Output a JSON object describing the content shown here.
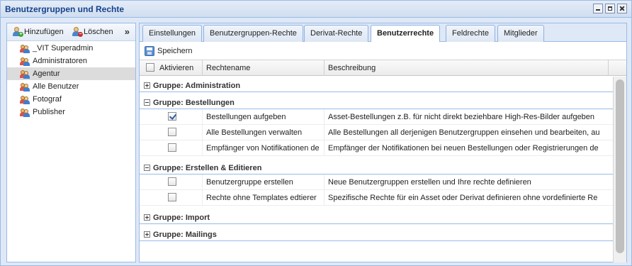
{
  "window": {
    "title": "Benutzergruppen und Rechte"
  },
  "left": {
    "add_label": "Hinzufügen",
    "delete_label": "Löschen",
    "collapse_symbol": "»",
    "groups": [
      {
        "name": "_VIT Superadmin",
        "selected": false
      },
      {
        "name": "Administratoren",
        "selected": false
      },
      {
        "name": "Agentur",
        "selected": true
      },
      {
        "name": "Alle Benutzer",
        "selected": false
      },
      {
        "name": "Fotograf",
        "selected": false
      },
      {
        "name": "Publisher",
        "selected": false
      }
    ]
  },
  "tabs": [
    {
      "label": "Einstellungen",
      "active": false
    },
    {
      "label": "Benutzergruppen-Rechte",
      "active": false
    },
    {
      "label": "Derivat-Rechte",
      "active": false
    },
    {
      "label": "Benutzerrechte",
      "active": true
    },
    {
      "label": "Feldrechte",
      "active": false
    },
    {
      "label": "Mitglieder",
      "active": false
    }
  ],
  "toolbar": {
    "save_label": "Speichern"
  },
  "grid": {
    "col_activate": "Aktivieren",
    "col_name": "Rechtename",
    "col_desc": "Beschreibung",
    "groups": [
      {
        "title": "Gruppe: Administration",
        "expanded": false,
        "rows": []
      },
      {
        "title": "Gruppe: Bestellungen",
        "expanded": true,
        "rows": [
          {
            "checked": true,
            "name": "Bestellungen aufgeben",
            "desc": "Asset-Bestellungen z.B. für nicht direkt beziehbare High-Res-Bilder aufgeben"
          },
          {
            "checked": false,
            "name": "Alle Bestellungen verwalten",
            "desc": "Alle Bestellungen all derjenigen Benutzergruppen einsehen und bearbeiten, au"
          },
          {
            "checked": false,
            "name": "Empfänger von Notifikationen de",
            "desc": "Empfänger der Notifikationen bei neuen Bestellungen oder Registrierungen de"
          }
        ]
      },
      {
        "title": "Gruppe: Erstellen & Editieren",
        "expanded": true,
        "rows": [
          {
            "checked": false,
            "name": "Benutzergruppe erstellen",
            "desc": "Neue Benutzergruppen erstellen und Ihre rechte definieren"
          },
          {
            "checked": false,
            "name": "Rechte ohne Templates edtierer",
            "desc": "Spezifische Rechte für ein Asset oder Derivat definieren ohne vordefinierte Re"
          }
        ]
      },
      {
        "title": "Gruppe: Import",
        "expanded": false,
        "rows": []
      },
      {
        "title": "Gruppe: Mailings",
        "expanded": false,
        "rows": []
      }
    ]
  }
}
